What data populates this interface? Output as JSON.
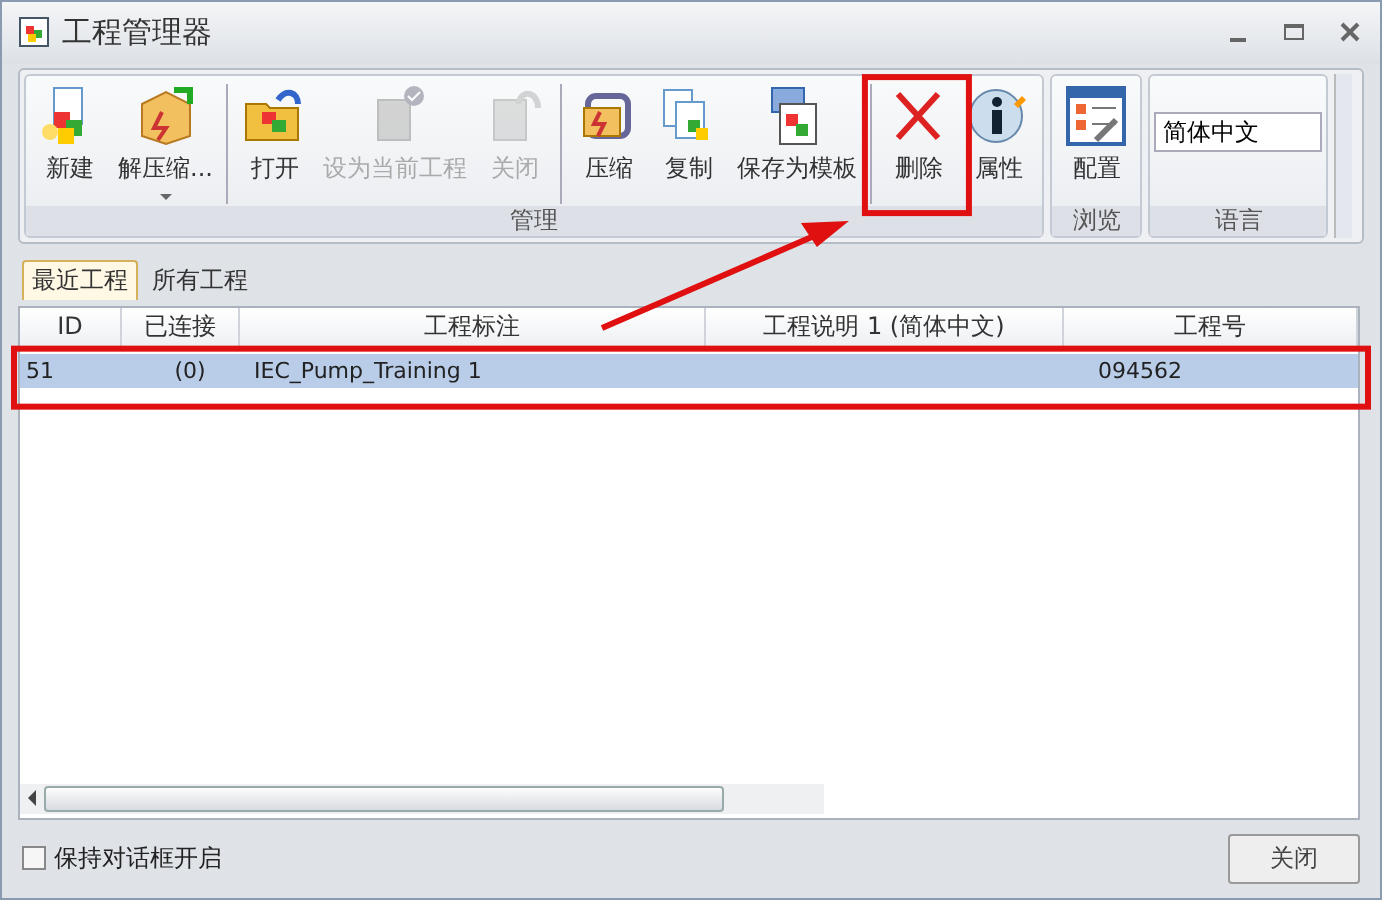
{
  "window": {
    "title": "工程管理器"
  },
  "ribbon": {
    "groups": [
      {
        "label": "管理",
        "buttons": [
          {
            "label": "新建",
            "disabled": false,
            "separator_before": false,
            "dropdown": false
          },
          {
            "label": "解压缩...",
            "disabled": false,
            "separator_before": false,
            "dropdown": true
          },
          {
            "label": "打开",
            "disabled": false,
            "separator_before": true,
            "dropdown": false
          },
          {
            "label": "设为当前工程",
            "disabled": true,
            "separator_before": false,
            "dropdown": false
          },
          {
            "label": "关闭",
            "disabled": true,
            "separator_before": false,
            "dropdown": false
          },
          {
            "label": "压缩",
            "disabled": false,
            "separator_before": true,
            "dropdown": false
          },
          {
            "label": "复制",
            "disabled": false,
            "separator_before": false,
            "dropdown": false
          },
          {
            "label": "保存为模板",
            "disabled": false,
            "separator_before": false,
            "dropdown": false
          },
          {
            "label": "删除",
            "disabled": false,
            "separator_before": true,
            "dropdown": false
          },
          {
            "label": "属性",
            "disabled": false,
            "separator_before": false,
            "dropdown": false
          }
        ]
      },
      {
        "label": "浏览",
        "buttons": [
          {
            "label": "配置",
            "disabled": false,
            "separator_before": false,
            "dropdown": false
          }
        ]
      },
      {
        "label": "语言",
        "select": {
          "value": "简体中文"
        }
      }
    ]
  },
  "tabs": [
    {
      "label": "最近工程",
      "selected": true
    },
    {
      "label": "所有工程",
      "selected": false
    }
  ],
  "table": {
    "columns": [
      "ID",
      "已连接",
      "工程标注",
      "工程说明 1 (简体中文)",
      "工程号"
    ],
    "rows": [
      {
        "cells": [
          "51",
          "(0)",
          "IEC_Pump_Training 1",
          "",
          "094562"
        ],
        "selected": true
      }
    ]
  },
  "footer": {
    "checkbox": {
      "label": "保持对话框开启",
      "checked": false
    },
    "button": "关闭"
  }
}
